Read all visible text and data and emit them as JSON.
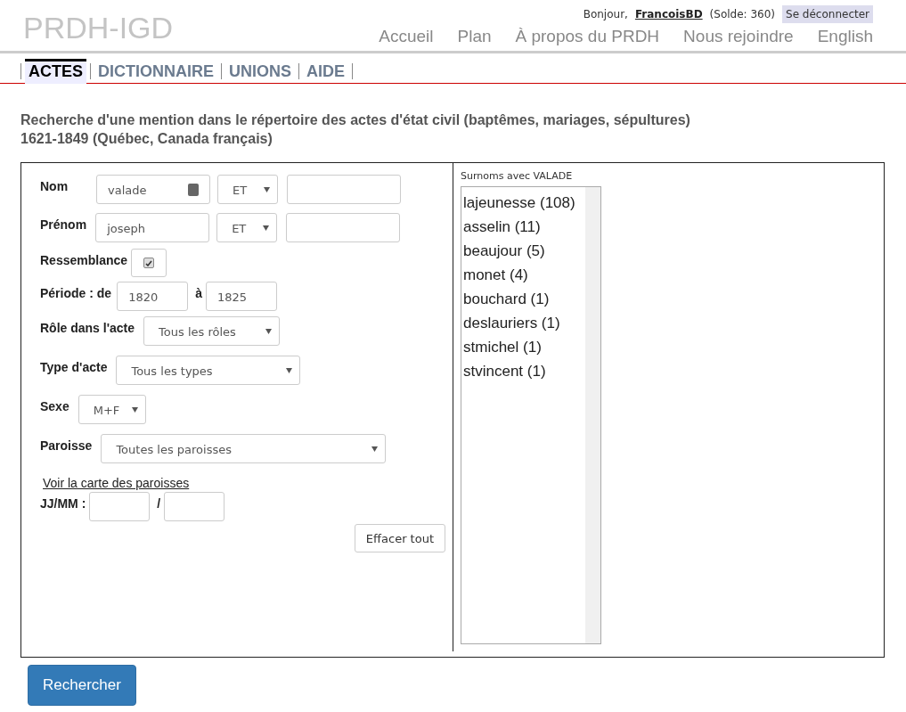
{
  "logo": "PRDH-IGD",
  "user_bar": {
    "greeting": "Bonjour,",
    "username": "FrancoisBD",
    "balance": "(Solde: 360)",
    "logout": "Se déconnecter"
  },
  "main_nav": [
    "Accueil",
    "Plan",
    "À propos du PRDH",
    "Nous rejoindre",
    "English"
  ],
  "tabs": [
    {
      "label": "ACTES",
      "selected": true
    },
    {
      "label": "DICTIONNAIRE",
      "selected": false
    },
    {
      "label": "UNIONS",
      "selected": false
    },
    {
      "label": "AIDE",
      "selected": false
    }
  ],
  "heading": [
    "Recherche d'une mention dans le répertoire des actes d'état civil (baptêmes, mariages, sépultures)",
    "1621-1849 (Québec, Canada français)"
  ],
  "form": {
    "nom": {
      "label": "Nom",
      "value": "valade",
      "operator": "ET"
    },
    "prenom": {
      "label": "Prénom",
      "value": "joseph",
      "operator": "ET"
    },
    "resemblance": {
      "label": "Ressemblance",
      "checked": true
    },
    "period": {
      "label": "Période : de",
      "from": "1820",
      "separator": "à",
      "to": "1825"
    },
    "role": {
      "label": "Rôle dans l'acte",
      "value": "Tous les rôles"
    },
    "type": {
      "label": "Type d'acte",
      "value": "Tous les types"
    },
    "sex": {
      "label": "Sexe",
      "value": "M+F"
    },
    "parish": {
      "label": "Paroisse",
      "value": "Toutes les paroisses"
    },
    "map_link": "Voir la carte des paroisses",
    "date": {
      "label": "JJ/MM :",
      "separator": "/"
    },
    "clear_button": "Effacer tout"
  },
  "surnames": {
    "title": "Surnoms avec VALADE",
    "items": [
      "lajeunesse (108)",
      "asselin (11)",
      "beaujour (5)",
      "monet (4)",
      "bouchard (1)",
      "deslauriers (1)",
      "stmichel (1)",
      "stvincent (1)"
    ]
  },
  "search_button": "Rechercher"
}
